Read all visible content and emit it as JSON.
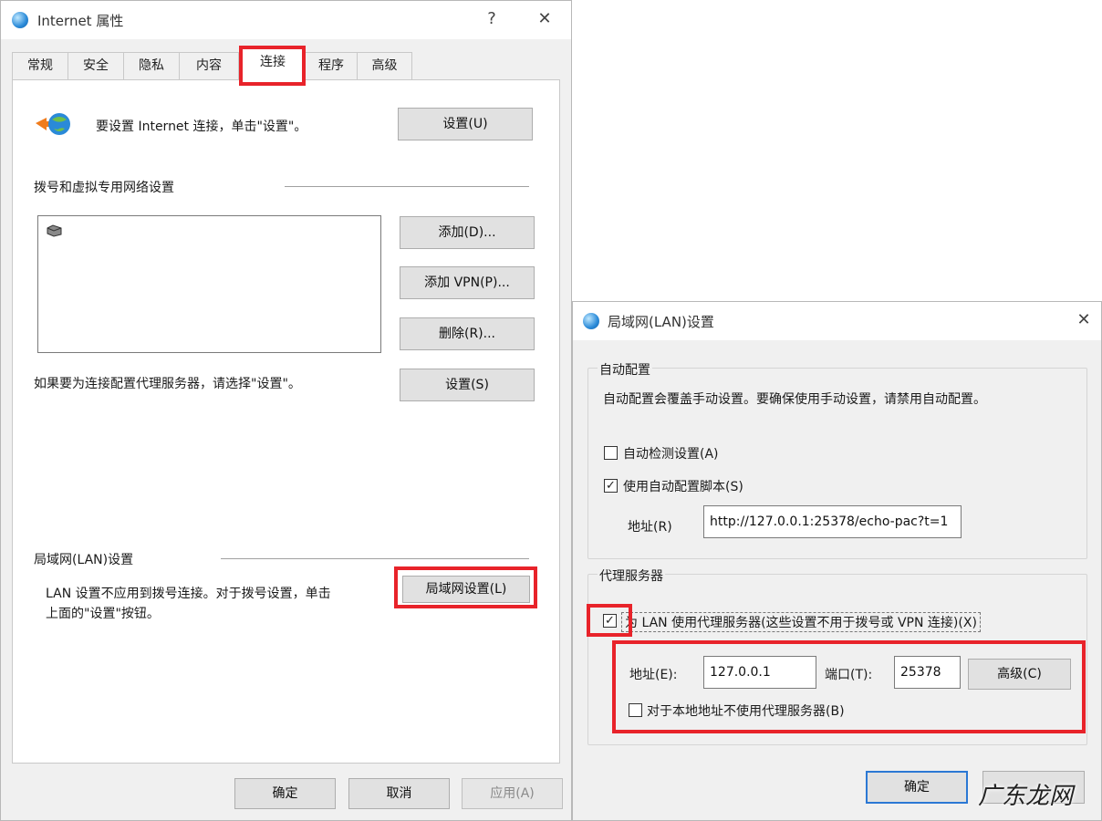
{
  "main_window": {
    "title": "Internet 属性",
    "help_glyph": "?",
    "close_glyph": "✕",
    "tabs": [
      "常规",
      "安全",
      "隐私",
      "内容",
      "连接",
      "程序",
      "高级"
    ],
    "active_tab": "连接",
    "setup": {
      "text": "要设置 Internet 连接，单击\"设置\"。",
      "button": "设置(U)"
    },
    "dialup": {
      "heading": "拨号和虚拟专用网络设置",
      "add_button": "添加(D)...",
      "add_vpn_button": "添加 VPN(P)...",
      "remove_button": "删除(R)...",
      "settings_button": "设置(S)",
      "proxy_hint": "如果要为连接配置代理服务器，请选择\"设置\"。"
    },
    "lan": {
      "heading": "局域网(LAN)设置",
      "desc_line1": "LAN 设置不应用到拨号连接。对于拨号设置，单击",
      "desc_line2": "上面的\"设置\"按钮。",
      "button": "局域网设置(L)"
    },
    "footer": {
      "ok": "确定",
      "cancel": "取消",
      "apply": "应用(A)"
    }
  },
  "lan_dialog": {
    "title": "局域网(LAN)设置",
    "close_glyph": "✕",
    "auto_config": {
      "heading": "自动配置",
      "desc": "自动配置会覆盖手动设置。要确保使用手动设置，请禁用自动配置。",
      "auto_detect_label": "自动检测设置(A)",
      "auto_detect_checked": false,
      "use_script_label": "使用自动配置脚本(S)",
      "use_script_checked": true,
      "address_label": "地址(R)",
      "address_value": "http://127.0.0.1:25378/echo-pac?t=1"
    },
    "proxy": {
      "heading": "代理服务器",
      "use_proxy_label": "为 LAN 使用代理服务器(这些设置不用于拨号或 VPN 连接)(X)",
      "use_proxy_checked": true,
      "address_label": "地址(E):",
      "address_value": "127.0.0.1",
      "port_label": "端口(T):",
      "port_value": "25378",
      "advanced_button": "高级(C)",
      "bypass_local_label": "对于本地地址不使用代理服务器(B)",
      "bypass_local_checked": false
    },
    "footer": {
      "ok": "确定",
      "cancel": ""
    }
  },
  "watermark": "广东龙网",
  "colors": {
    "highlight": "#e8232a",
    "accent": "#2b78d4"
  }
}
